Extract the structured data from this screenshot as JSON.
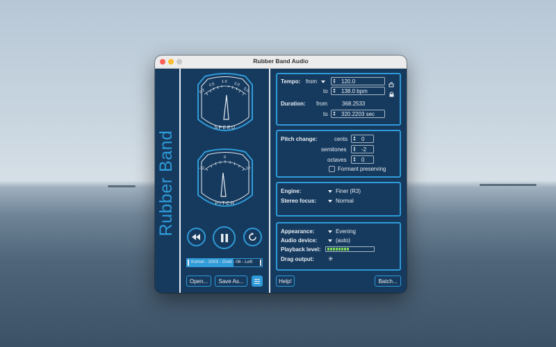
{
  "window": {
    "title": "Rubber Band Audio"
  },
  "brand": {
    "text": "Rubber Band"
  },
  "speed_meter": {
    "label": "SPEED",
    "ticks": [
      "0.2",
      "0.5",
      "1.0",
      "2.0",
      "5.0"
    ],
    "needle_fraction": 0.53
  },
  "pitch_meter": {
    "label": "PITCH",
    "ticks": [
      "-12",
      "0",
      "12"
    ],
    "needle_fraction": 0.43
  },
  "transport": {
    "rewind_icon": "rewind-icon",
    "pause_icon": "pause-icon",
    "loop_icon": "loop-icon"
  },
  "file": {
    "name": "Komet - 2003 - Gold - 06 - Left",
    "progress": 0.62
  },
  "buttons": {
    "open": "Open...",
    "save_as": "Save As...",
    "menu_icon": "list-icon",
    "help": "Help!",
    "batch": "Batch..."
  },
  "tempo": {
    "label": "Tempo:",
    "from_label": "from",
    "from_value": "120.0",
    "to_label": "to",
    "to_value": "138.0 bpm",
    "link_icon": "link-icon",
    "lock_icon": "lock-icon"
  },
  "duration": {
    "label": "Duration:",
    "from_label": "from",
    "from_value": "368.2533",
    "to_label": "to",
    "to_value": "320.2203 sec"
  },
  "pitch_change": {
    "label": "Pitch change:",
    "cents_label": "cents",
    "cents_value": "0",
    "semitones_label": "semitones",
    "semitones_value": "-2",
    "octaves_label": "octaves",
    "octaves_value": "0",
    "formant_label": "Formant preserving",
    "formant_checked": false
  },
  "engine": {
    "label": "Engine:",
    "value": "Finer (R3)",
    "stereo_label": "Stereo focus:",
    "stereo_value": "Normal"
  },
  "output": {
    "appearance_label": "Appearance:",
    "appearance_value": "Evening",
    "device_label": "Audio device:",
    "device_value": "(auto)",
    "level_label": "Playback level:",
    "level_fraction": 0.42,
    "drag_label": "Drag output:",
    "drag_icon": "drag-icon"
  },
  "colors": {
    "window_bg": "#163a5e",
    "accent": "#2f9bd8",
    "text": "#e9eef3",
    "level": "#7ed957"
  }
}
